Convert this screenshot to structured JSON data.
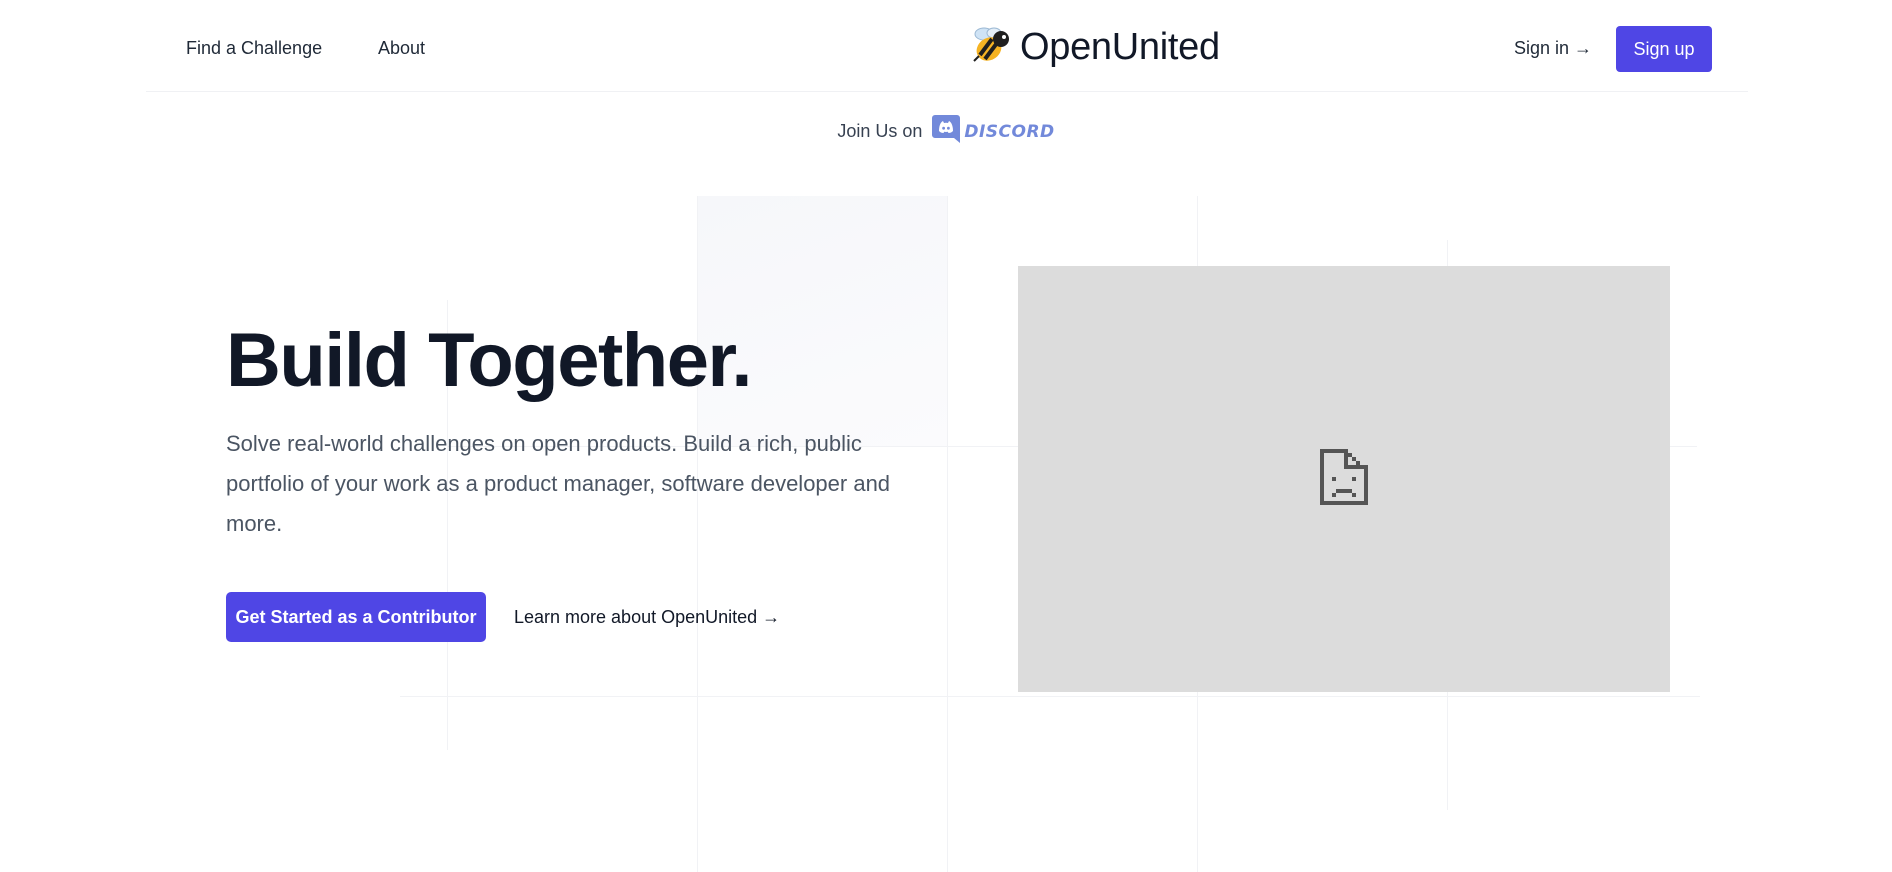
{
  "header": {
    "nav": [
      {
        "label": "Find a Challenge"
      },
      {
        "label": "About"
      }
    ],
    "logo": {
      "text": "OpenUnited",
      "icon": "bee-icon"
    },
    "signin_label": "Sign in →",
    "signup_label": "Sign up"
  },
  "banner": {
    "text": "Join Us on",
    "discord_label": "DISCORD",
    "discord_icon": "discord-icon"
  },
  "hero": {
    "title": "Build Together.",
    "subtitle": "Solve real-world challenges on open products. Build a rich, public portfolio of your work as a product manager, software developer and more.",
    "cta_label": "Get Started as a Contributor",
    "learn_label": "Learn more about OpenUnited →",
    "image_icon": "broken-image-icon"
  },
  "colors": {
    "accent": "#4f46e5",
    "discord": "#7289da",
    "heading": "#111827",
    "body": "#4b5563",
    "image_bg": "#dcdcdc"
  }
}
